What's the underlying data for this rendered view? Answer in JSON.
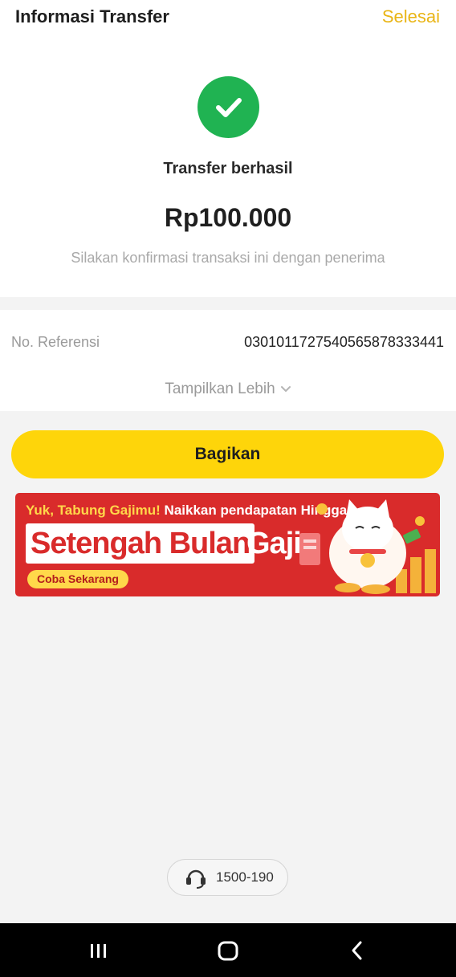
{
  "header": {
    "title": "Informasi Transfer",
    "done_label": "Selesai"
  },
  "result": {
    "status": "Transfer berhasil",
    "amount": "Rp100.000",
    "note": "Silakan konfirmasi transaksi ini dengan penerima"
  },
  "details": {
    "reference_label": "No. Referensi",
    "reference_value": "030101172754056587833 3441",
    "show_more_label": "Tampilkan Lebih"
  },
  "share_label": "Bagikan",
  "promo": {
    "line1_highlight": "Yuk, Tabung Gajimu!",
    "line1_rest": " Naikkan pendapatan Hingga",
    "headline": "Setengah Bulan",
    "headline_suffix": "Gaji",
    "cta": "Coba Sekarang"
  },
  "support": {
    "number": "1500-190"
  },
  "colors": {
    "accent_yellow": "#fed50a",
    "success_green": "#20b352",
    "promo_red": "#d92b2b"
  }
}
